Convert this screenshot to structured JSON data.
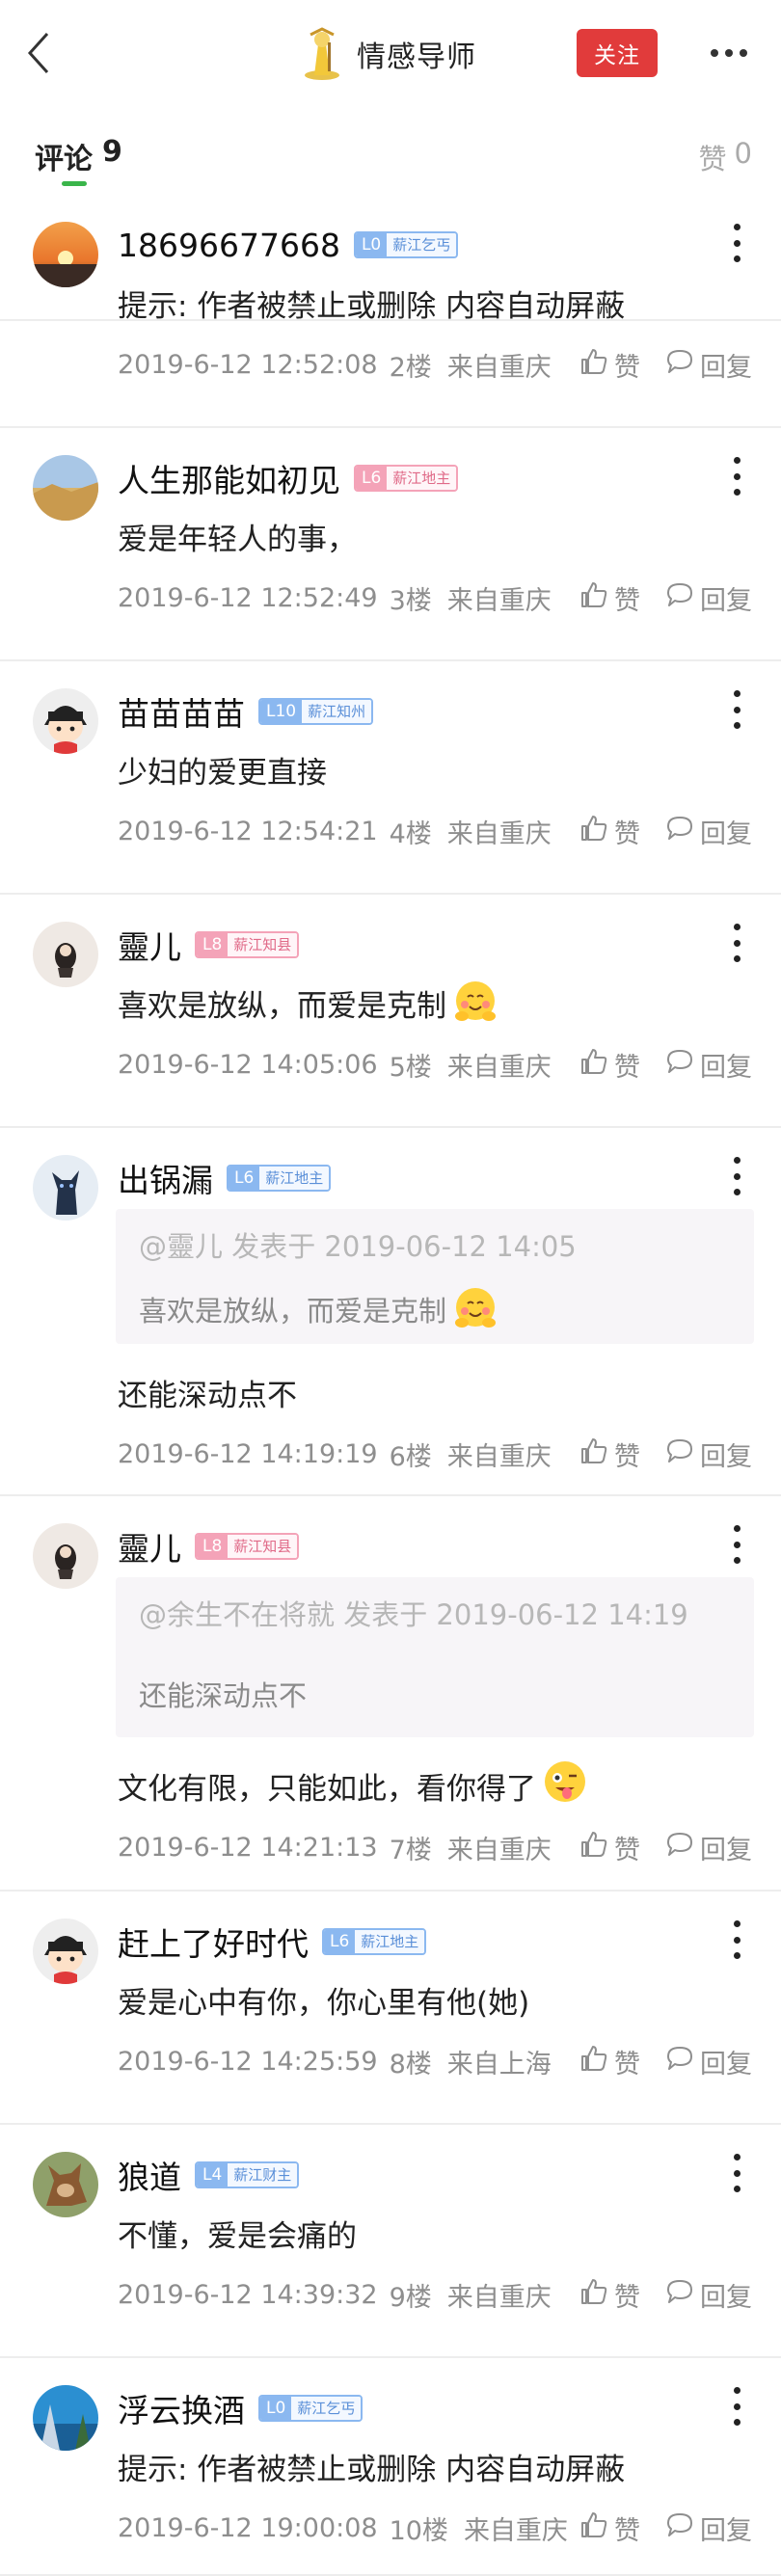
{
  "header": {
    "author_name": "情感导师",
    "follow_label": "关注"
  },
  "tabs": {
    "comments_label": "评论",
    "comments_count": "9",
    "likes_label": "赞",
    "likes_count": "0"
  },
  "actions": {
    "like_label": "赞",
    "reply_label": "回复"
  },
  "comments": [
    {
      "username": "18696677668",
      "level": "L0",
      "title": "薪江乞丐",
      "badge_color": "blue",
      "text": "提示: 作者被禁止或删除 内容自动屏蔽",
      "time": "2019-6-12 12:52:08",
      "floor": "2楼",
      "location": "来自重庆",
      "avatar": "sunset"
    },
    {
      "username": "人生那能如初见",
      "level": "L6",
      "title": "薪江地主",
      "badge_color": "pink",
      "text": "爱是年轻人的事，",
      "time": "2019-6-12 12:52:49",
      "floor": "3楼",
      "location": "来自重庆",
      "avatar": "field"
    },
    {
      "username": "苗苗苗苗",
      "level": "L10",
      "title": "薪江知州",
      "badge_color": "blue",
      "text": "少妇的爱更直接",
      "time": "2019-6-12 12:54:21",
      "floor": "4楼",
      "location": "来自重庆",
      "avatar": "cartoon"
    },
    {
      "username": "靈儿",
      "level": "L8",
      "title": "薪江知县",
      "badge_color": "pink",
      "text": "喜欢是放纵，而爱是克制",
      "text_emoji": "blush",
      "time": "2019-6-12 14:05:06",
      "floor": "5楼",
      "location": "来自重庆",
      "avatar": "girl"
    },
    {
      "username": "出锅漏",
      "level": "L6",
      "title": "薪江地主",
      "badge_color": "blue",
      "quote_head": "@靈儿 发表于 2019-06-12 14:05",
      "quote_text": "喜欢是放纵，而爱是克制",
      "quote_emoji": "blush",
      "text": "还能深动点不",
      "time": "2019-6-12 14:19:19",
      "floor": "6楼",
      "location": "来自重庆",
      "avatar": "dog-dark"
    },
    {
      "username": "靈儿",
      "level": "L8",
      "title": "薪江知县",
      "badge_color": "pink",
      "quote_head": "@余生不在将就 发表于 2019-06-12 14:19",
      "quote_text": "还能深动点不",
      "text": "文化有限，只能如此，看你得了",
      "text_emoji": "tongue",
      "time": "2019-6-12 14:21:13",
      "floor": "7楼",
      "location": "来自重庆",
      "avatar": "girl"
    },
    {
      "username": "赶上了好时代",
      "level": "L6",
      "title": "薪江地主",
      "badge_color": "blue",
      "text": "爱是心中有你，你心里有他(她)",
      "time": "2019-6-12 14:25:59",
      "floor": "8楼",
      "location": "来自上海",
      "avatar": "cartoon"
    },
    {
      "username": "狼道",
      "level": "L4",
      "title": "薪江财主",
      "badge_color": "blue",
      "text": "不懂，爱是会痛的",
      "time": "2019-6-12 14:39:32",
      "floor": "9楼",
      "location": "来自重庆",
      "avatar": "dog-brown"
    },
    {
      "username": "浮云换酒",
      "level": "L0",
      "title": "薪江乞丐",
      "badge_color": "blue",
      "text": "提示: 作者被禁止或删除 内容自动屏蔽",
      "time": "2019-6-12 19:00:08",
      "floor": "10楼",
      "location": "来自重庆",
      "avatar": "sea"
    }
  ],
  "colors": {
    "follow_bg": "#e13b3b",
    "tab_underline": "#3ab54a",
    "badge_blue": "#8bb8f0",
    "badge_pink": "#f4a3b8"
  }
}
